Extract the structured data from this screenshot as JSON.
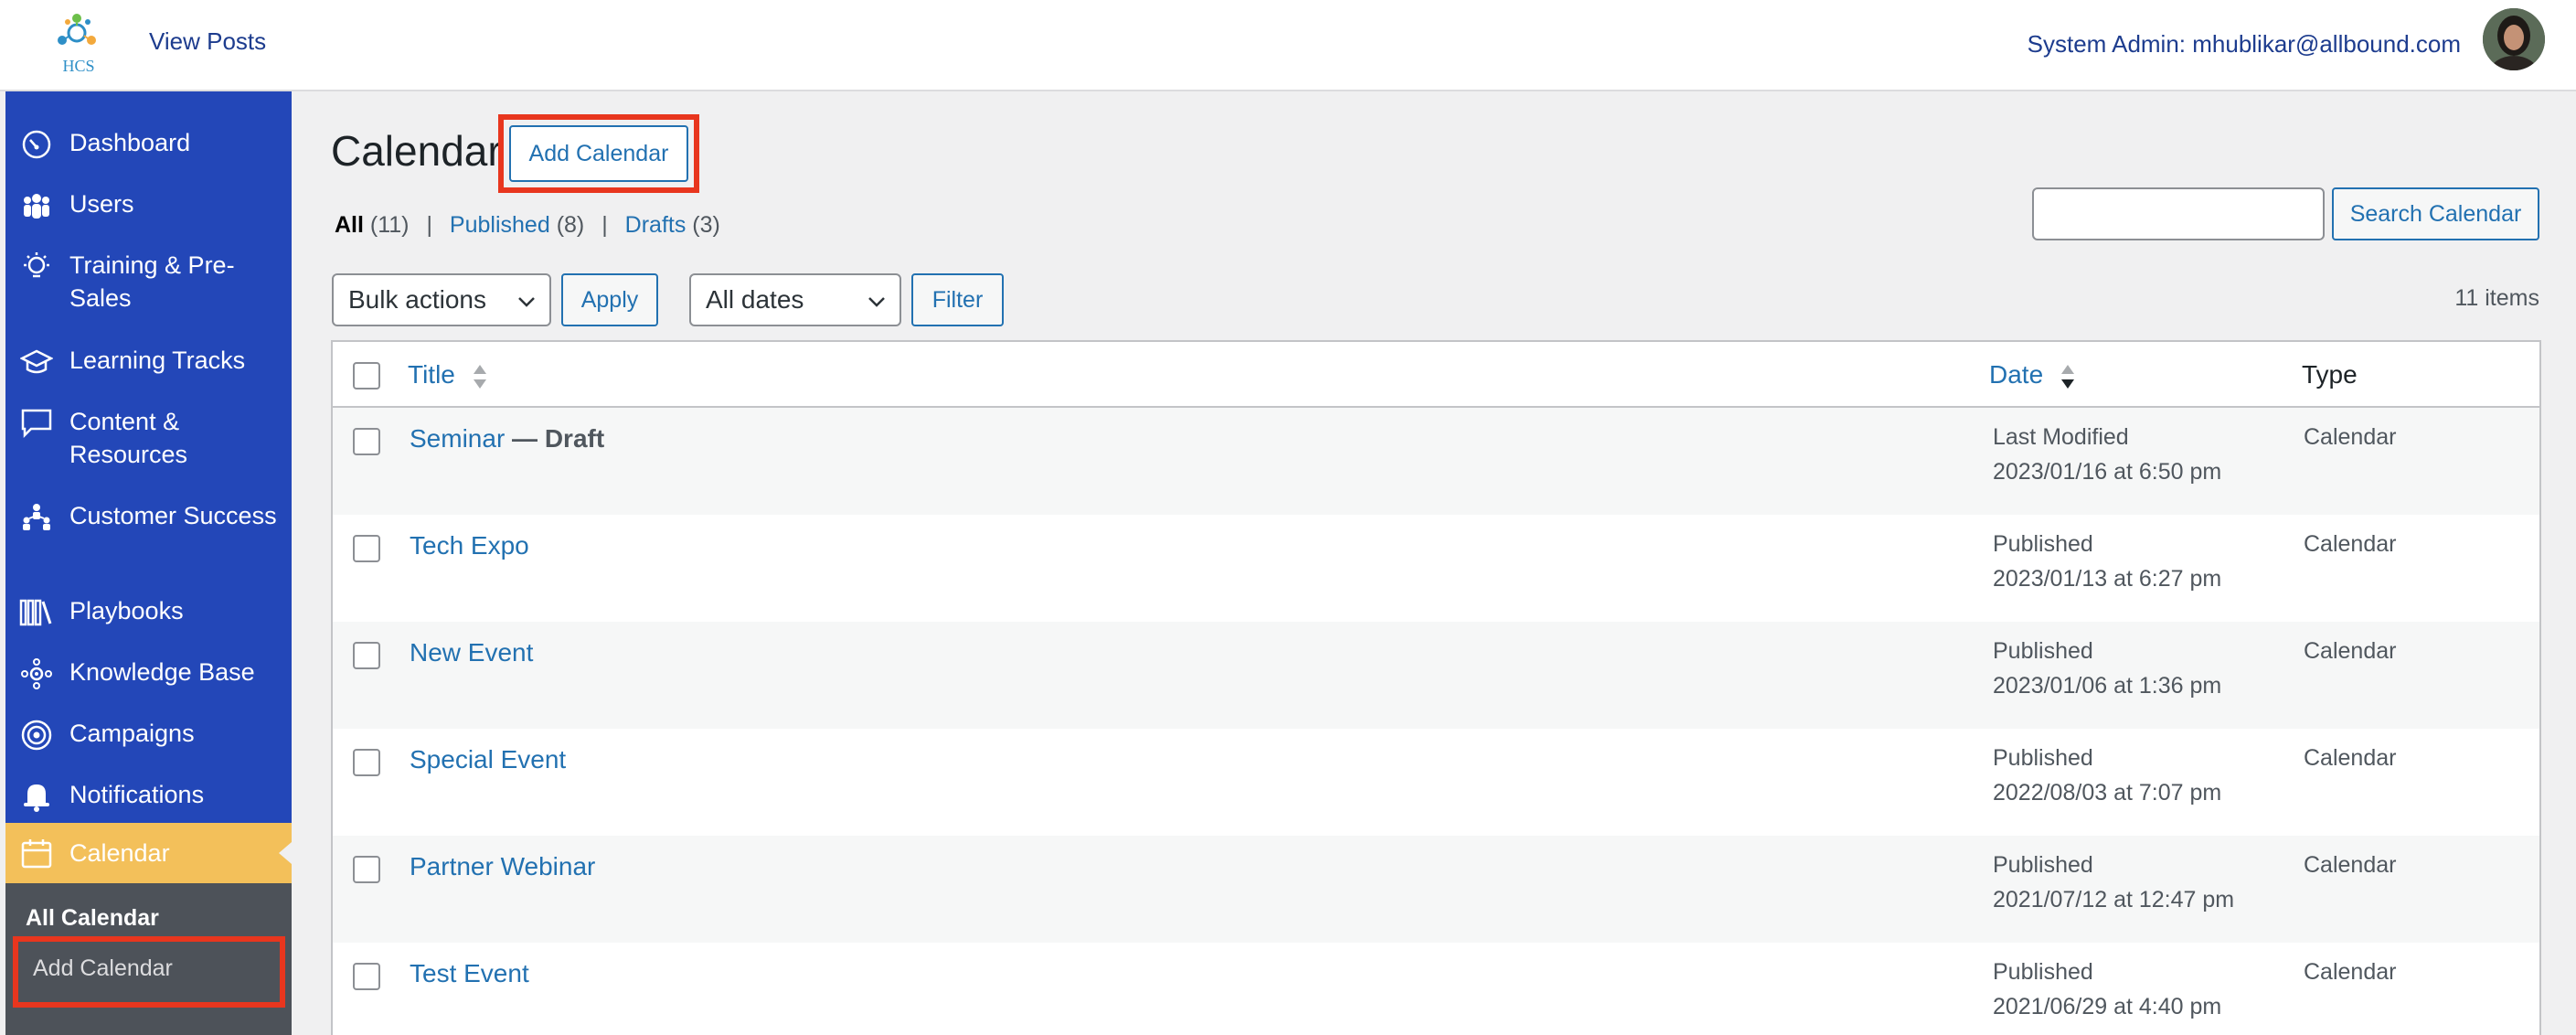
{
  "topbar": {
    "view_posts": "View Posts",
    "admin": "System Admin: mhublikar@allbound.com",
    "logo_text": "HCS"
  },
  "sidebar": {
    "items": [
      {
        "label": "Dashboard",
        "icon": "dashboard-icon"
      },
      {
        "label": "Users",
        "icon": "users-icon"
      },
      {
        "label": "Training & Pre-Sales",
        "icon": "lightbulb-icon"
      },
      {
        "label": "Learning Tracks",
        "icon": "graduation-cap-icon"
      },
      {
        "label": "Content & Resources",
        "icon": "speech-bubble-icon"
      },
      {
        "label": "Customer Success",
        "icon": "people-network-icon"
      },
      {
        "label": "Playbooks",
        "icon": "books-icon"
      },
      {
        "label": "Knowledge Base",
        "icon": "knowledge-icon"
      },
      {
        "label": "Campaigns",
        "icon": "target-icon"
      },
      {
        "label": "Notifications",
        "icon": "bell-icon"
      },
      {
        "label": "Calendar",
        "icon": "calendar-icon"
      }
    ],
    "submenu": {
      "all": "All Calendar",
      "add": "Add Calendar"
    }
  },
  "page": {
    "title": "Calendar",
    "add_button": "Add Calendar",
    "filters": {
      "all": "All",
      "all_count": "(11)",
      "published": "Published",
      "published_count": "(8)",
      "drafts": "Drafts",
      "drafts_count": "(3)"
    },
    "search_button": "Search Calendar",
    "search_value": "",
    "bulk_actions": "Bulk actions",
    "apply": "Apply",
    "dates": "All dates",
    "filter": "Filter",
    "items_count": "11 items"
  },
  "table": {
    "headers": {
      "title": "Title",
      "date": "Date",
      "type": "Type"
    },
    "rows": [
      {
        "title": "Seminar",
        "state": " — Draft",
        "status": "Last Modified",
        "date": "2023/01/16 at 6:50 pm",
        "type": "Calendar"
      },
      {
        "title": "Tech Expo",
        "state": "",
        "status": "Published",
        "date": "2023/01/13 at 6:27 pm",
        "type": "Calendar"
      },
      {
        "title": "New Event",
        "state": "",
        "status": "Published",
        "date": "2023/01/06 at 1:36 pm",
        "type": "Calendar"
      },
      {
        "title": "Special Event",
        "state": "",
        "status": "Published",
        "date": "2022/08/03 at 7:07 pm",
        "type": "Calendar"
      },
      {
        "title": "Partner Webinar",
        "state": "",
        "status": "Published",
        "date": "2021/07/12 at 12:47 pm",
        "type": "Calendar"
      },
      {
        "title": "Test Event",
        "state": "",
        "status": "Published",
        "date": "2021/06/29 at 4:40 pm",
        "type": "Calendar"
      }
    ]
  }
}
